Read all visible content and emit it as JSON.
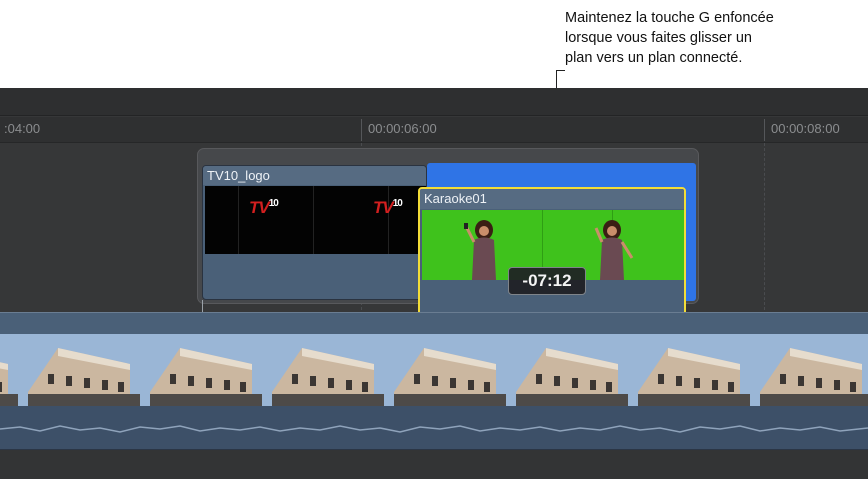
{
  "callout": {
    "lines": [
      "Maintenez la touche G enfoncée",
      "lorsque vous faites glisser un",
      "plan vers un plan connecté."
    ]
  },
  "ruler": {
    "labels": [
      ":04:00",
      "00:00:06:00",
      "00:00:08:00"
    ]
  },
  "clips": {
    "tv": {
      "title": "TV10_logo",
      "logo_text": "TV",
      "logo_number": "10"
    },
    "karaoke": {
      "title": "Karaoke01"
    }
  },
  "drag": {
    "duration_delta": "-07:12"
  },
  "colors": {
    "timeline_bg": "#363738",
    "clip_blue_gray": "#4a6078",
    "selection_yellow": "#f3dd37",
    "drop_target_blue": "#2f74e6",
    "green_screen": "#3fc21c",
    "logo_red": "#d21f1f"
  }
}
